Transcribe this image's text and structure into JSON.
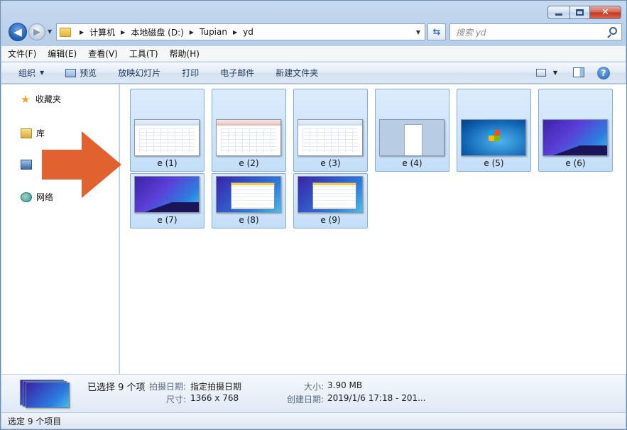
{
  "window": {
    "caption": {
      "min": "",
      "max": "",
      "close": "✕"
    }
  },
  "nav": {
    "breadcrumbs": [
      "计算机",
      "本地磁盘 (D:)",
      "Tupian",
      "yd"
    ],
    "search_placeholder": "搜索 yd"
  },
  "menu": [
    "文件(F)",
    "编辑(E)",
    "查看(V)",
    "工具(T)",
    "帮助(H)"
  ],
  "toolbar": {
    "organize": "组织",
    "preview": "预览",
    "slideshow": "放映幻灯片",
    "print": "打印",
    "email": "电子邮件",
    "new_folder": "新建文件夹"
  },
  "sidebar": {
    "favorites": "收藏夹",
    "libraries": "库",
    "network": "网络"
  },
  "files": [
    {
      "name": "e (1)",
      "thumb": "excel"
    },
    {
      "name": "e (2)",
      "thumb": "excel-red"
    },
    {
      "name": "e (3)",
      "thumb": "excel"
    },
    {
      "name": "e (4)",
      "thumb": "word"
    },
    {
      "name": "e (5)",
      "thumb": "win7"
    },
    {
      "name": "e (6)",
      "thumb": "purple"
    },
    {
      "name": "e (7)",
      "thumb": "purple"
    },
    {
      "name": "e (8)",
      "thumb": "app"
    },
    {
      "name": "e (9)",
      "thumb": "app"
    }
  ],
  "details": {
    "selected": "已选择 9 个项",
    "date_taken_label": "拍摄日期:",
    "date_taken_value": "指定拍摄日期",
    "dimensions_label": "尺寸:",
    "dimensions_value": "1366 x 768",
    "size_label": "大小:",
    "size_value": "3.90 MB",
    "created_label": "创建日期:",
    "created_value": "2019/1/6 17:18 - 201..."
  },
  "status": {
    "text": "选定 9 个项目"
  },
  "colors": {
    "arrow": "#e2622f",
    "selection": "#cce1f7",
    "accent": "#1f5db1"
  }
}
